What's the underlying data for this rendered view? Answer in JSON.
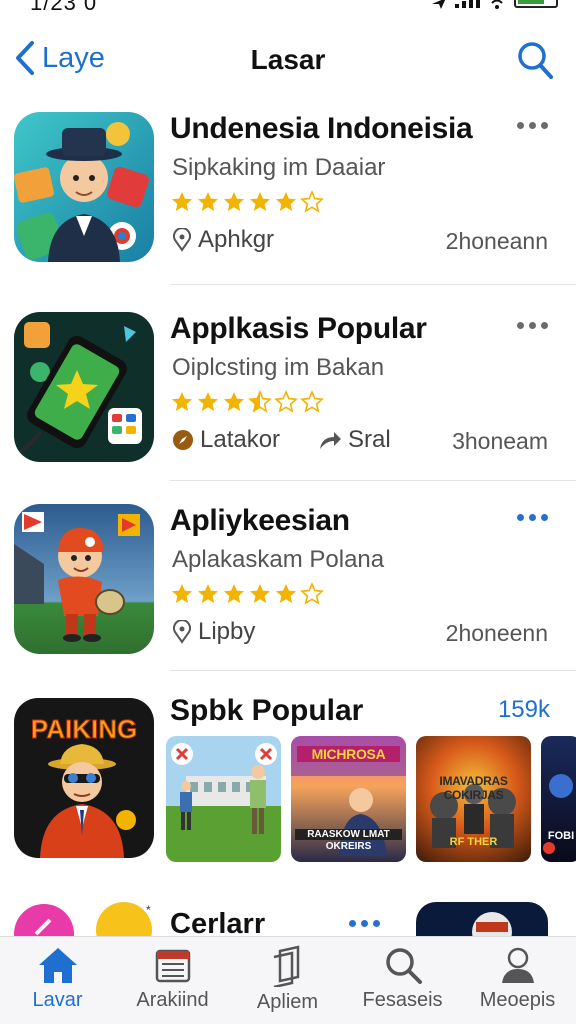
{
  "status": {
    "time": "1/23 0"
  },
  "header": {
    "back_label": "Laye",
    "title": "Lasar"
  },
  "apps": [
    {
      "name": "Undenesia Indoneisia",
      "subtitle": "Sipkaking im Daaiar",
      "rating": 4.5,
      "meta_left": "Aphkgr",
      "meta_mid": "",
      "meta_right": "2honeann"
    },
    {
      "name": "Applkasis Popular",
      "subtitle": "Oiplcsting im Bakan",
      "rating": 3.5,
      "meta_left": "Latakor",
      "meta_mid": "Sral",
      "meta_right": "3honeam"
    },
    {
      "name": "Apliykeesian",
      "subtitle": "Aplakaskam Polana",
      "rating": 4.5,
      "meta_left": "Lipby",
      "meta_mid": "",
      "meta_right": "2honeenn"
    }
  ],
  "section": {
    "title": "Spbk Popular",
    "count": "159k",
    "icon_text": "PAIKING",
    "thumbs": [
      {
        "title": "",
        "sub": "",
        "sub2": ""
      },
      {
        "title": "MICHROSA",
        "sub": "RAASKOW LMAT",
        "sub2": "OKREIRS"
      },
      {
        "title": "IMAVADRAS COKIRJAS",
        "sub": "RF THER",
        "sub2": ""
      },
      {
        "title": "",
        "sub": "FOBI",
        "sub2": ""
      }
    ]
  },
  "partial": {
    "title": "Cerlarr"
  },
  "tabs": [
    {
      "label": "Lavar",
      "icon": "home-icon"
    },
    {
      "label": "Arakiind",
      "icon": "calendar-icon"
    },
    {
      "label": "Apliem",
      "icon": "layers-icon"
    },
    {
      "label": "Fesaseis",
      "icon": "search-icon"
    },
    {
      "label": "Meoepis",
      "icon": "person-icon"
    }
  ],
  "colors": {
    "accent": "#1f6fd1",
    "star": "#f2b400"
  }
}
